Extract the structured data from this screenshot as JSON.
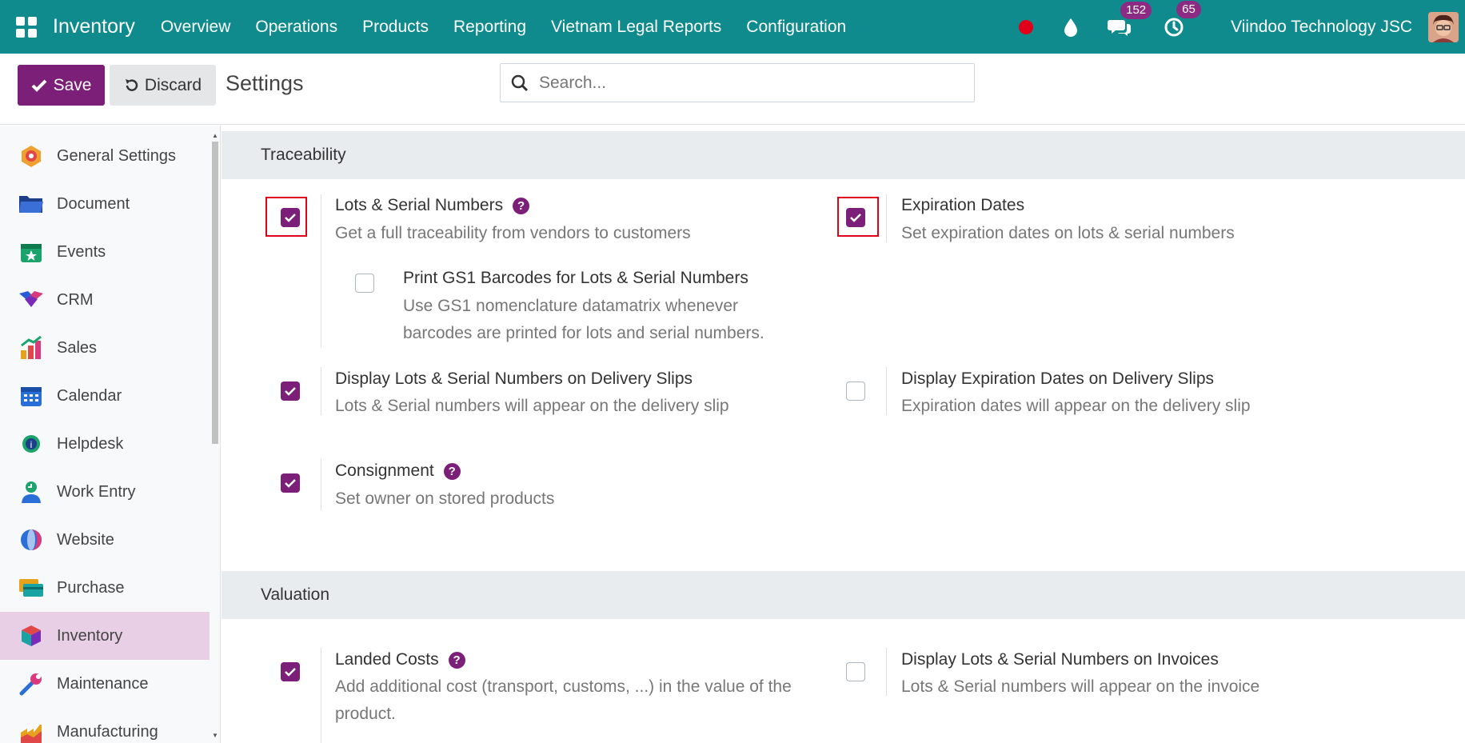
{
  "navbar": {
    "app_name": "Inventory",
    "menu": [
      "Overview",
      "Operations",
      "Products",
      "Reporting",
      "Vietnam Legal Reports",
      "Configuration"
    ],
    "messages_count": "152",
    "activities_count": "65",
    "company": "Viindoo Technology JSC"
  },
  "control": {
    "save_label": "Save",
    "discard_label": "Discard",
    "title": "Settings",
    "search_placeholder": "Search..."
  },
  "sidebar": {
    "items": [
      {
        "label": "General Settings",
        "icon": "general-settings-icon"
      },
      {
        "label": "Document",
        "icon": "folder-icon"
      },
      {
        "label": "Events",
        "icon": "calendar-star-icon"
      },
      {
        "label": "CRM",
        "icon": "handshake-icon"
      },
      {
        "label": "Sales",
        "icon": "bar-chart-icon"
      },
      {
        "label": "Calendar",
        "icon": "calendar-icon"
      },
      {
        "label": "Helpdesk",
        "icon": "headset-icon"
      },
      {
        "label": "Work Entry",
        "icon": "person-clock-icon"
      },
      {
        "label": "Website",
        "icon": "globe-icon"
      },
      {
        "label": "Purchase",
        "icon": "credit-card-icon"
      },
      {
        "label": "Inventory",
        "icon": "cube-icon",
        "active": true
      },
      {
        "label": "Maintenance",
        "icon": "wrench-icon"
      },
      {
        "label": "Manufacturing",
        "icon": "factory-icon"
      }
    ]
  },
  "sections": {
    "traceability": {
      "title": "Traceability",
      "lots": {
        "title": "Lots & Serial Numbers",
        "desc": "Get a full traceability from vendors to customers",
        "checked": true
      },
      "expiration": {
        "title": "Expiration Dates",
        "desc": "Set expiration dates on lots & serial numbers",
        "checked": true
      },
      "gs1": {
        "title": "Print GS1 Barcodes for Lots & Serial Numbers",
        "desc": "Use GS1 nomenclature datamatrix whenever barcodes are printed for lots and serial numbers.",
        "checked": false
      },
      "display_lots_delivery": {
        "title": "Display Lots & Serial Numbers on Delivery Slips",
        "desc": "Lots & Serial numbers will appear on the delivery slip",
        "checked": true
      },
      "display_exp_delivery": {
        "title": "Display Expiration Dates on Delivery Slips",
        "desc": "Expiration dates will appear on the delivery slip",
        "checked": false
      },
      "consignment": {
        "title": "Consignment",
        "desc": "Set owner on stored products",
        "checked": true
      }
    },
    "valuation": {
      "title": "Valuation",
      "landed_costs": {
        "title": "Landed Costs",
        "desc": "Add additional cost (transport, customs, ...) in the value of the product.",
        "checked": true
      },
      "display_lots_invoices": {
        "title": "Display Lots & Serial Numbers on Invoices",
        "desc": "Lots & Serial numbers will appear on the invoice",
        "checked": false
      }
    }
  },
  "colors": {
    "navbar": "#0f8b8d",
    "primary": "#7c1f78",
    "highlight_box": "#e0001a"
  }
}
